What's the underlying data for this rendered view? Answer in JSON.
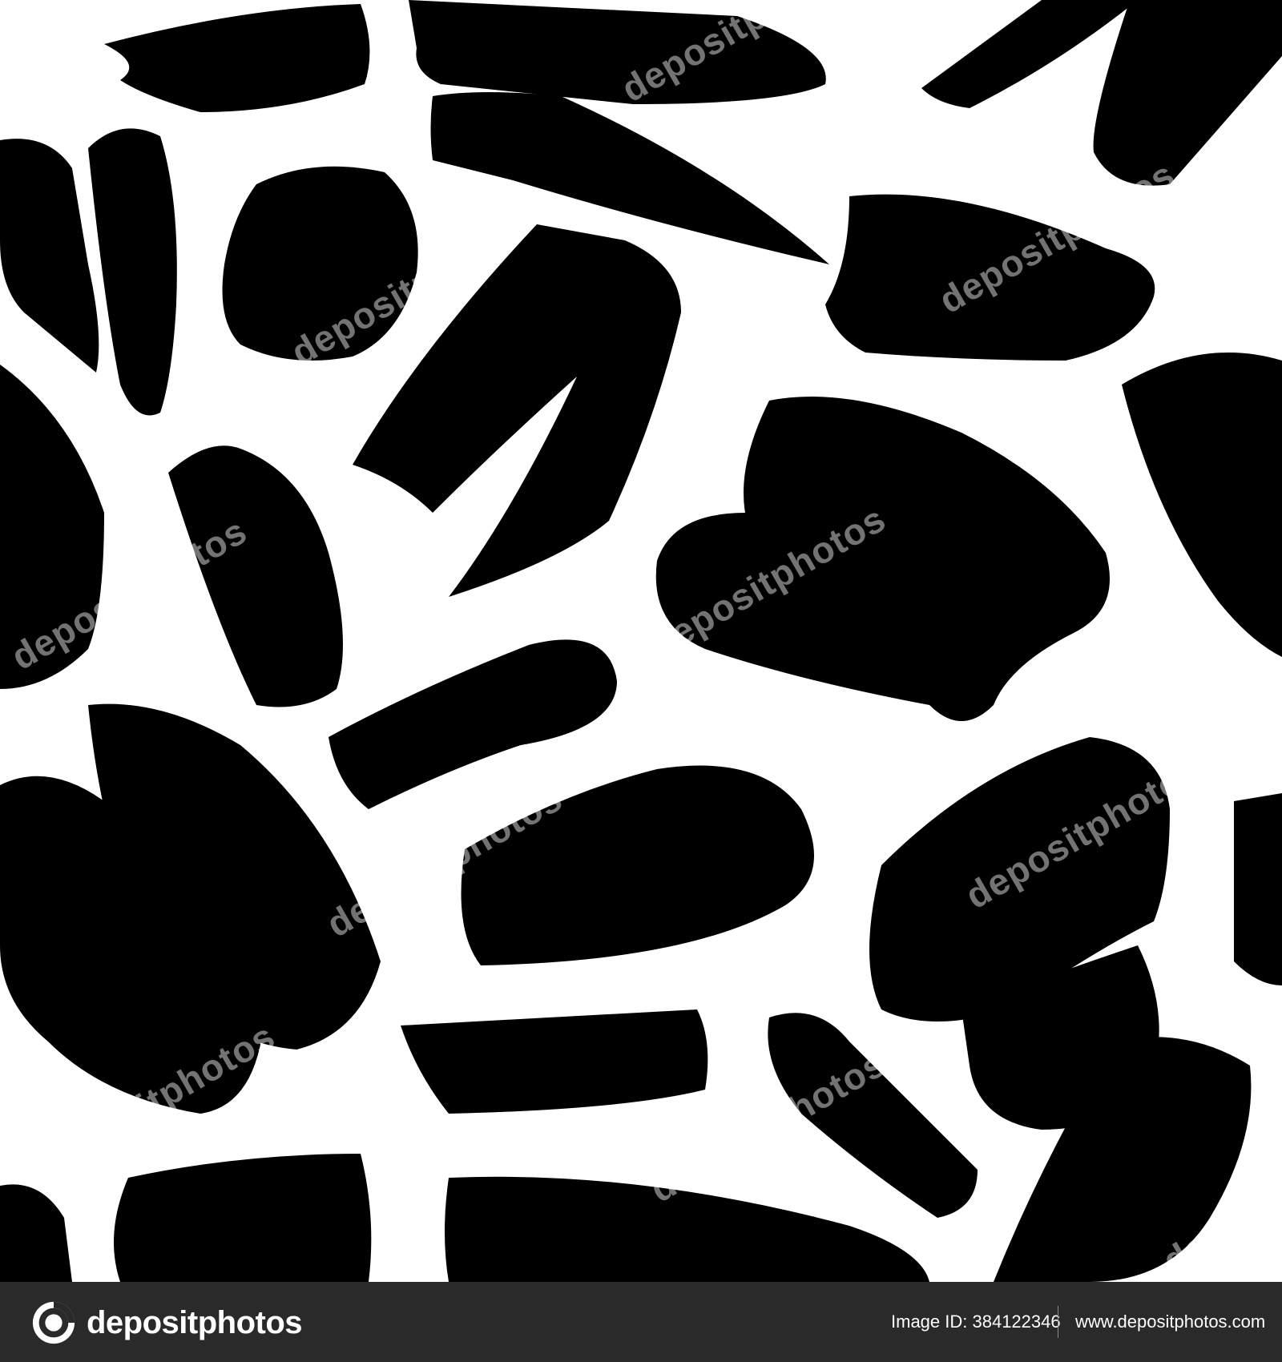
{
  "watermark": {
    "text": "depositphotos",
    "color": "#ffffff"
  },
  "pattern": {
    "ink_color": "#000000",
    "paper_color": "#ffffff"
  },
  "footer": {
    "brand": "depositphotos",
    "image_id_label": "Image ID: 384122346",
    "site_url": "www.depositphotos.com",
    "background": "#2a2a2a",
    "icon": "depositphotos-logo-icon"
  }
}
